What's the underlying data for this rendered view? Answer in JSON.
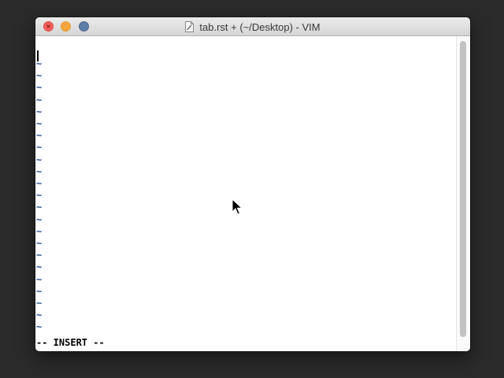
{
  "window": {
    "title": "tab.rst + (~/Desktop) - VIM",
    "controls": {
      "close": "close-button",
      "minimize": "minimize-button",
      "zoom": "zoom-button"
    }
  },
  "editor": {
    "empty_line_marker": "~",
    "empty_line_count": 23,
    "mode_text": "-- INSERT --"
  },
  "icons": {
    "document": "document-icon",
    "mouse_pointer": "mouse-pointer-icon"
  },
  "colors": {
    "tilde": "#1f4f8f",
    "close": "#fc605c",
    "minimize": "#f9a53f",
    "zoom": "#5b7fa8"
  }
}
